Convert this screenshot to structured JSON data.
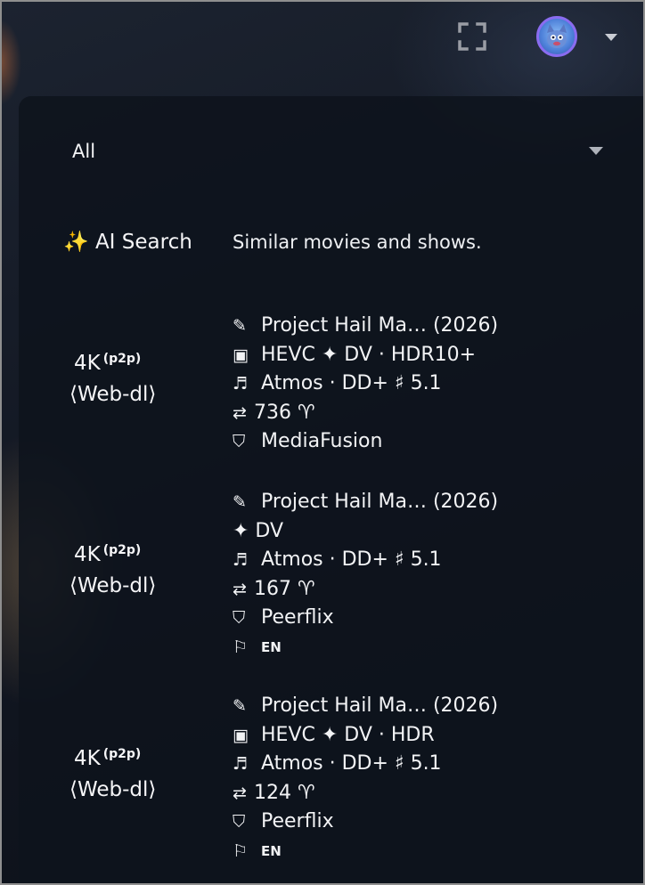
{
  "topbar": {
    "fullscreen_icon": "fullscreen-icon",
    "avatar_icon": "avatar-image",
    "menu_chevron_icon": "chevron-down-icon"
  },
  "filter": {
    "selected": "All",
    "chevron_icon": "chevron-down-icon"
  },
  "ai_search": {
    "icon": "✨",
    "label": "AI Search",
    "description": "Similar movies and shows."
  },
  "streams": [
    {
      "quality": "4K",
      "quality_tag": "(p2p)",
      "rip": "⟨Web-dl⟩",
      "title_icon": "✎",
      "title": "Project Hail Ma… (2026)",
      "video_icon": "▣",
      "video": "HEVC ✦ DV · HDR10+",
      "audio_icon": "♬",
      "audio": "Atmos · DD+ ♯ 5.1",
      "peers_icon": "⇄",
      "peers": "736 ♈",
      "source_icon": "⛉",
      "source": "MediaFusion",
      "lang": ""
    },
    {
      "quality": "4K",
      "quality_tag": "(p2p)",
      "rip": "⟨Web-dl⟩",
      "title_icon": "✎",
      "title": "Project Hail Ma… (2026)",
      "video_icon": "",
      "video": "✦ DV",
      "audio_icon": "♬",
      "audio": "Atmos · DD+ ♯ 5.1",
      "peers_icon": "⇄",
      "peers": "167 ♈",
      "source_icon": "⛉",
      "source": "Peerflix",
      "lang_icon": "⚐",
      "lang": "EN"
    },
    {
      "quality": "4K",
      "quality_tag": "(p2p)",
      "rip": "⟨Web-dl⟩",
      "title_icon": "✎",
      "title": "Project Hail Ma… (2026)",
      "video_icon": "▣",
      "video": "HEVC ✦ DV · HDR",
      "audio_icon": "♬",
      "audio": "Atmos · DD+ ♯ 5.1",
      "peers_icon": "⇄",
      "peers": "124 ♈",
      "source_icon": "⛉",
      "source": "Peerflix",
      "lang_icon": "⚐",
      "lang": "EN"
    }
  ],
  "colors": {
    "accent_ring": "#8a6cf0",
    "panel_bg": "#0e131c"
  }
}
